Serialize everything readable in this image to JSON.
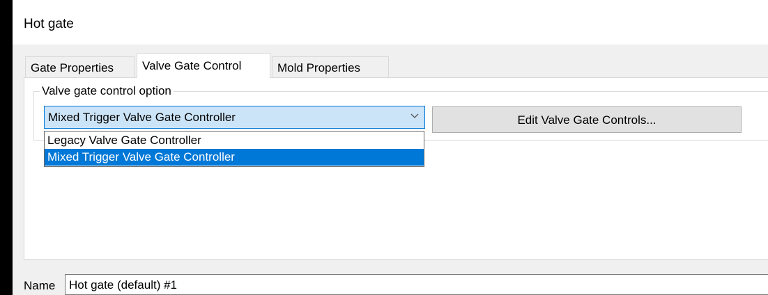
{
  "window": {
    "title": "Hot gate"
  },
  "tabs": [
    {
      "label": "Gate Properties",
      "active": false
    },
    {
      "label": "Valve Gate Control",
      "active": true
    },
    {
      "label": "Mold Properties",
      "active": false
    }
  ],
  "valve_gate": {
    "group_label": "Valve gate control option",
    "selected_value": "Mixed Trigger Valve Gate Controller",
    "options": [
      "Legacy Valve Gate Controller",
      "Mixed Trigger Valve Gate Controller"
    ],
    "highlighted_option_index": 1,
    "edit_button_label": "Edit Valve Gate Controls..."
  },
  "name_field": {
    "label": "Name",
    "value": "Hot gate (default) #1"
  },
  "colors": {
    "selection": "#0078d7",
    "combo_focus_bg": "#cce4f7",
    "dialog_bg": "#f0f0f0"
  }
}
